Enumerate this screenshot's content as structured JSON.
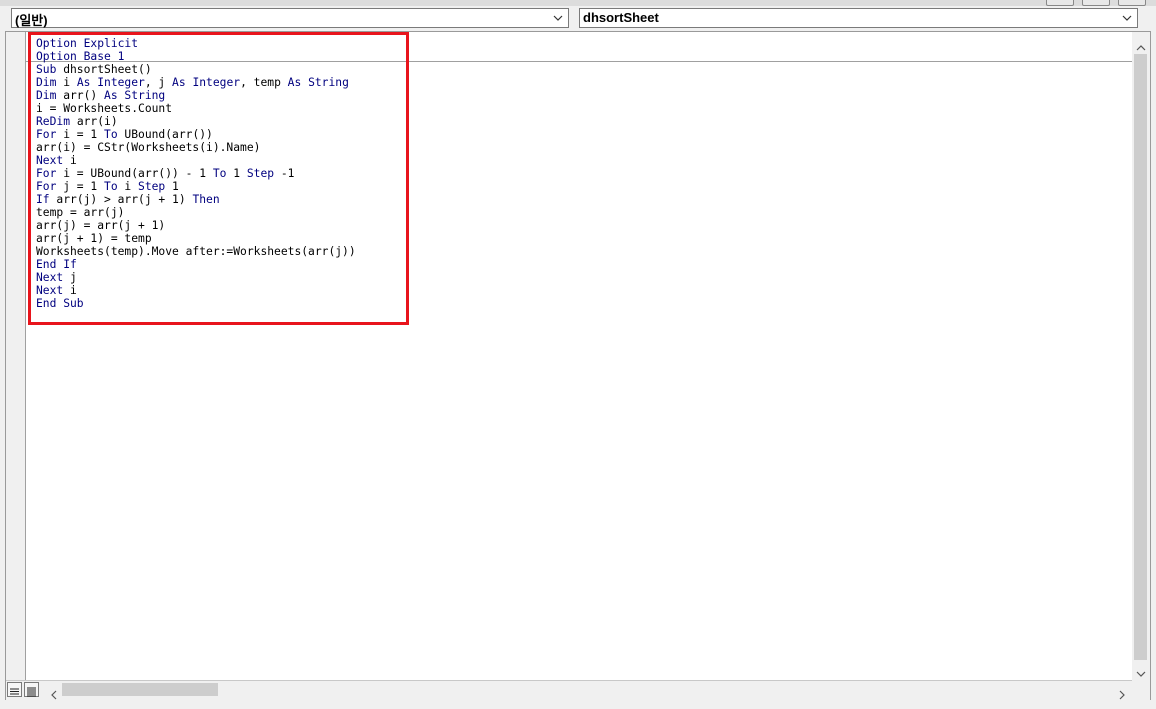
{
  "object_combo": {
    "value": "(일반)"
  },
  "procedure_combo": {
    "value": "dhsortSheet"
  },
  "code_lines": [
    [
      {
        "t": "Option Explicit",
        "k": true
      }
    ],
    [
      {
        "t": "Option Base 1",
        "k": true
      }
    ],
    [
      {
        "t": "Sub",
        "k": true
      },
      {
        "t": " dhsortSheet()",
        "k": false
      }
    ],
    [
      {
        "t": "Dim",
        "k": true
      },
      {
        "t": " i ",
        "k": false
      },
      {
        "t": "As Integer",
        "k": true
      },
      {
        "t": ", j ",
        "k": false
      },
      {
        "t": "As Integer",
        "k": true
      },
      {
        "t": ", temp ",
        "k": false
      },
      {
        "t": "As String",
        "k": true
      }
    ],
    [
      {
        "t": "Dim",
        "k": true
      },
      {
        "t": " arr() ",
        "k": false
      },
      {
        "t": "As String",
        "k": true
      }
    ],
    [
      {
        "t": "i = Worksheets.Count",
        "k": false
      }
    ],
    [
      {
        "t": "ReDim",
        "k": true
      },
      {
        "t": " arr(i)",
        "k": false
      }
    ],
    [
      {
        "t": "For",
        "k": true
      },
      {
        "t": " i = 1 ",
        "k": false
      },
      {
        "t": "To",
        "k": true
      },
      {
        "t": " UBound(arr())",
        "k": false
      }
    ],
    [
      {
        "t": "arr(i) = CStr(Worksheets(i).Name)",
        "k": false
      }
    ],
    [
      {
        "t": "Next",
        "k": true
      },
      {
        "t": " i",
        "k": false
      }
    ],
    [
      {
        "t": "For",
        "k": true
      },
      {
        "t": " i = UBound(arr()) - 1 ",
        "k": false
      },
      {
        "t": "To",
        "k": true
      },
      {
        "t": " 1 ",
        "k": false
      },
      {
        "t": "Step",
        "k": true
      },
      {
        "t": " -1",
        "k": false
      }
    ],
    [
      {
        "t": "For",
        "k": true
      },
      {
        "t": " j = 1 ",
        "k": false
      },
      {
        "t": "To",
        "k": true
      },
      {
        "t": " i ",
        "k": false
      },
      {
        "t": "Step",
        "k": true
      },
      {
        "t": " 1",
        "k": false
      }
    ],
    [
      {
        "t": "If",
        "k": true
      },
      {
        "t": " arr(j) > arr(j + 1) ",
        "k": false
      },
      {
        "t": "Then",
        "k": true
      }
    ],
    [
      {
        "t": "temp = arr(j)",
        "k": false
      }
    ],
    [
      {
        "t": "arr(j) = arr(j + 1)",
        "k": false
      }
    ],
    [
      {
        "t": "arr(j + 1) = temp",
        "k": false
      }
    ],
    [
      {
        "t": "Worksheets(temp).Move after:=Worksheets(arr(j))",
        "k": false
      }
    ],
    [
      {
        "t": "End If",
        "k": true
      }
    ],
    [
      {
        "t": "Next",
        "k": true
      },
      {
        "t": " j",
        "k": false
      }
    ],
    [
      {
        "t": "Next",
        "k": true
      },
      {
        "t": " i",
        "k": false
      }
    ],
    [
      {
        "t": "End Sub",
        "k": true
      }
    ]
  ],
  "colors": {
    "keyword": "#00007f",
    "text": "#000000",
    "highlight_box": "#e8141c"
  },
  "icons": {
    "object_combo_arrow": "chevron-down-icon",
    "procedure_combo_arrow": "chevron-down-icon",
    "scroll_up": "arrow-up-icon",
    "scroll_down": "arrow-down-icon",
    "scroll_left": "arrow-left-icon",
    "scroll_right": "arrow-right-icon",
    "procedure_view": "procedure-view-icon",
    "full_module_view": "full-module-view-icon"
  }
}
